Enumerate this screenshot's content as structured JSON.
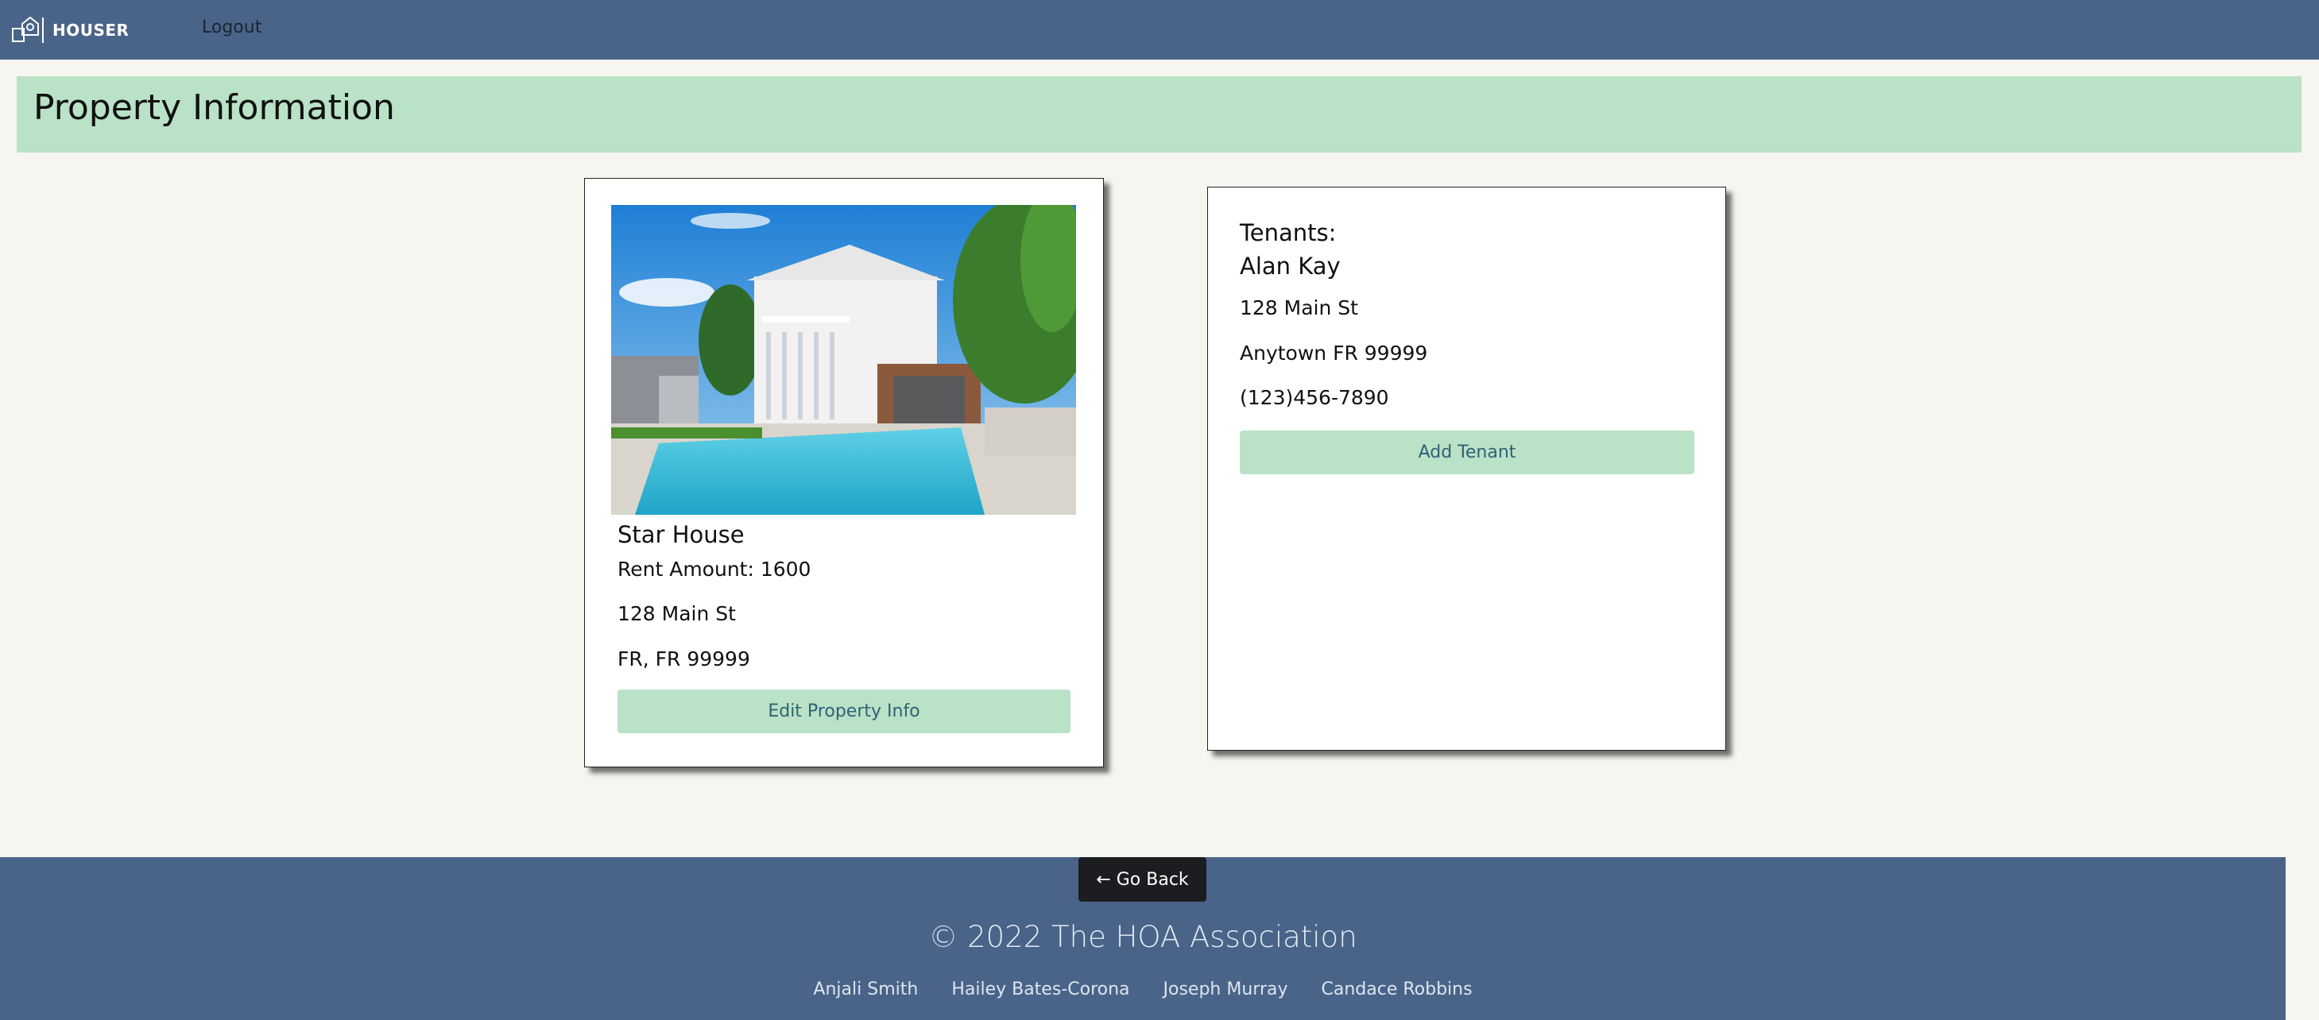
{
  "nav": {
    "brand": "HOUSER",
    "logout_label": "Logout"
  },
  "header": {
    "title": "Property Information"
  },
  "property": {
    "name": "Star House",
    "rent": "Rent Amount: 1600",
    "street": "128 Main St",
    "city_state_zip": "FR, FR 99999",
    "edit_label": "Edit Property Info"
  },
  "tenants": {
    "heading": "Tenants:",
    "name": "Alan Kay",
    "street": "128 Main St",
    "city_state_zip": "Anytown FR 99999",
    "phone": "(123)456-7890",
    "add_label": "Add Tenant"
  },
  "footer": {
    "goback_label": "← Go Back",
    "copyright": "© 2022 The HOA Association",
    "authors": [
      "Anjali Smith",
      "Hailey Bates-Corona",
      "Joseph Murray",
      "Candace Robbins"
    ]
  },
  "colors": {
    "navbar": "#4a6489",
    "accent_green": "#b9e2c6",
    "background": "#f6f5f0"
  }
}
